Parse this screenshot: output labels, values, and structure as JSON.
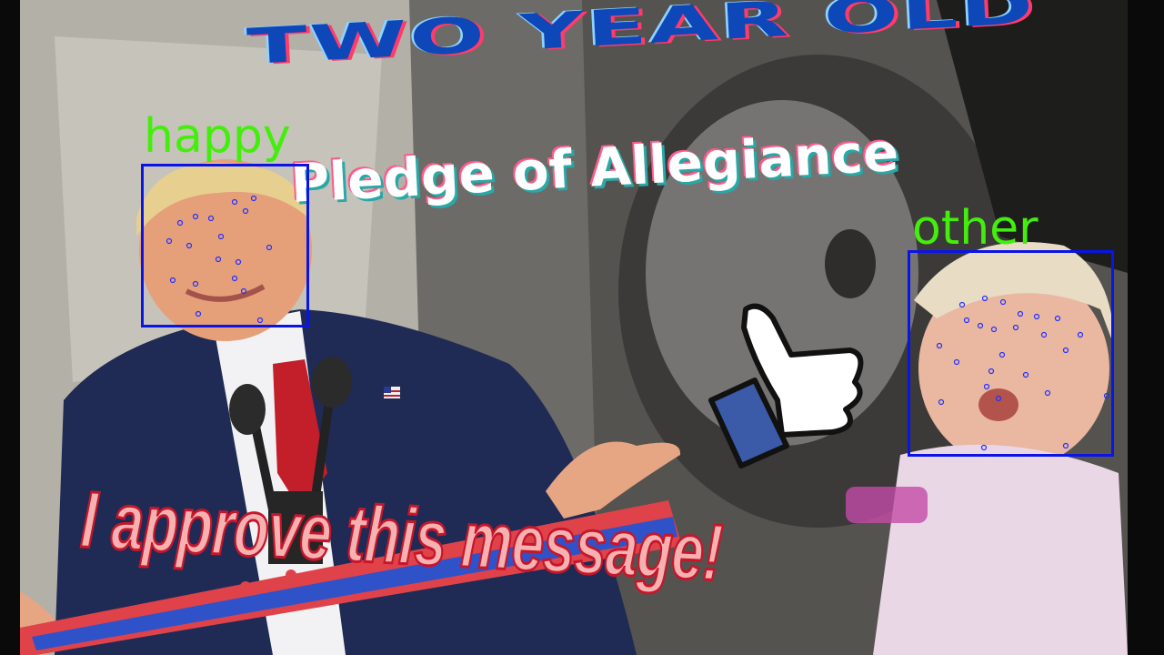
{
  "title": "TWO YEAR OLD",
  "subtitle": "Pledge of Allegiance",
  "caption": "I approve this message!",
  "detections": [
    {
      "label": "happy"
    },
    {
      "label": "other"
    }
  ],
  "icons": [
    "thumbs-up-icon",
    "flag-pin-icon"
  ],
  "colors": {
    "title": "#0d47b8",
    "label": "#44ee0c",
    "face_box": "#0a14e6",
    "caption_fill": "#f6b1b1",
    "caption_stroke": "#c7162b",
    "banner_blue": "#2f52c9",
    "banner_red": "#e0424a"
  }
}
